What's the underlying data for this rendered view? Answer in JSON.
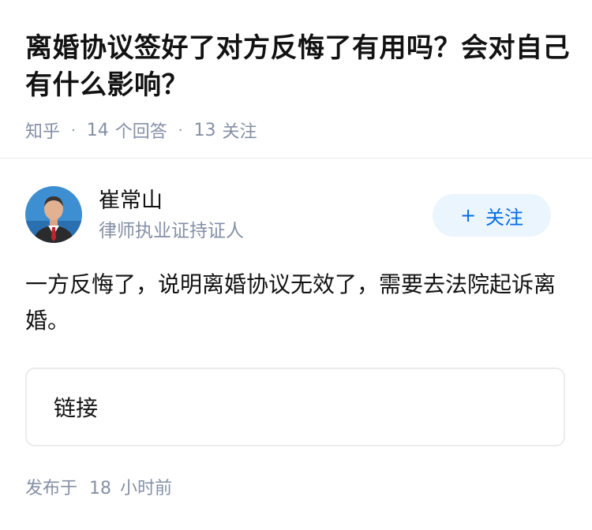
{
  "question": {
    "title": "离婚协议签好了对方反悔了有用吗？会对自己有什么影响？",
    "source": "知乎",
    "answer_count": "14",
    "answer_label": "个回答",
    "follower_count": "13",
    "follower_label": "关注"
  },
  "author": {
    "name": "崔常山",
    "badge": "律师执业证持证人",
    "follow_label": "关注"
  },
  "answer": {
    "content": "一方反悔了，说明离婚协议无效了，需要去法院起诉离婚。",
    "link_label": "链接"
  },
  "footer": {
    "published_prefix": "发布于",
    "published_number": "18",
    "published_unit": "小时前"
  },
  "icons": {
    "follow": "plus-icon",
    "separator": "dot"
  },
  "colors": {
    "accent": "#056de8",
    "muted": "#8590a6",
    "follow_bg": "#ebf5fd"
  }
}
